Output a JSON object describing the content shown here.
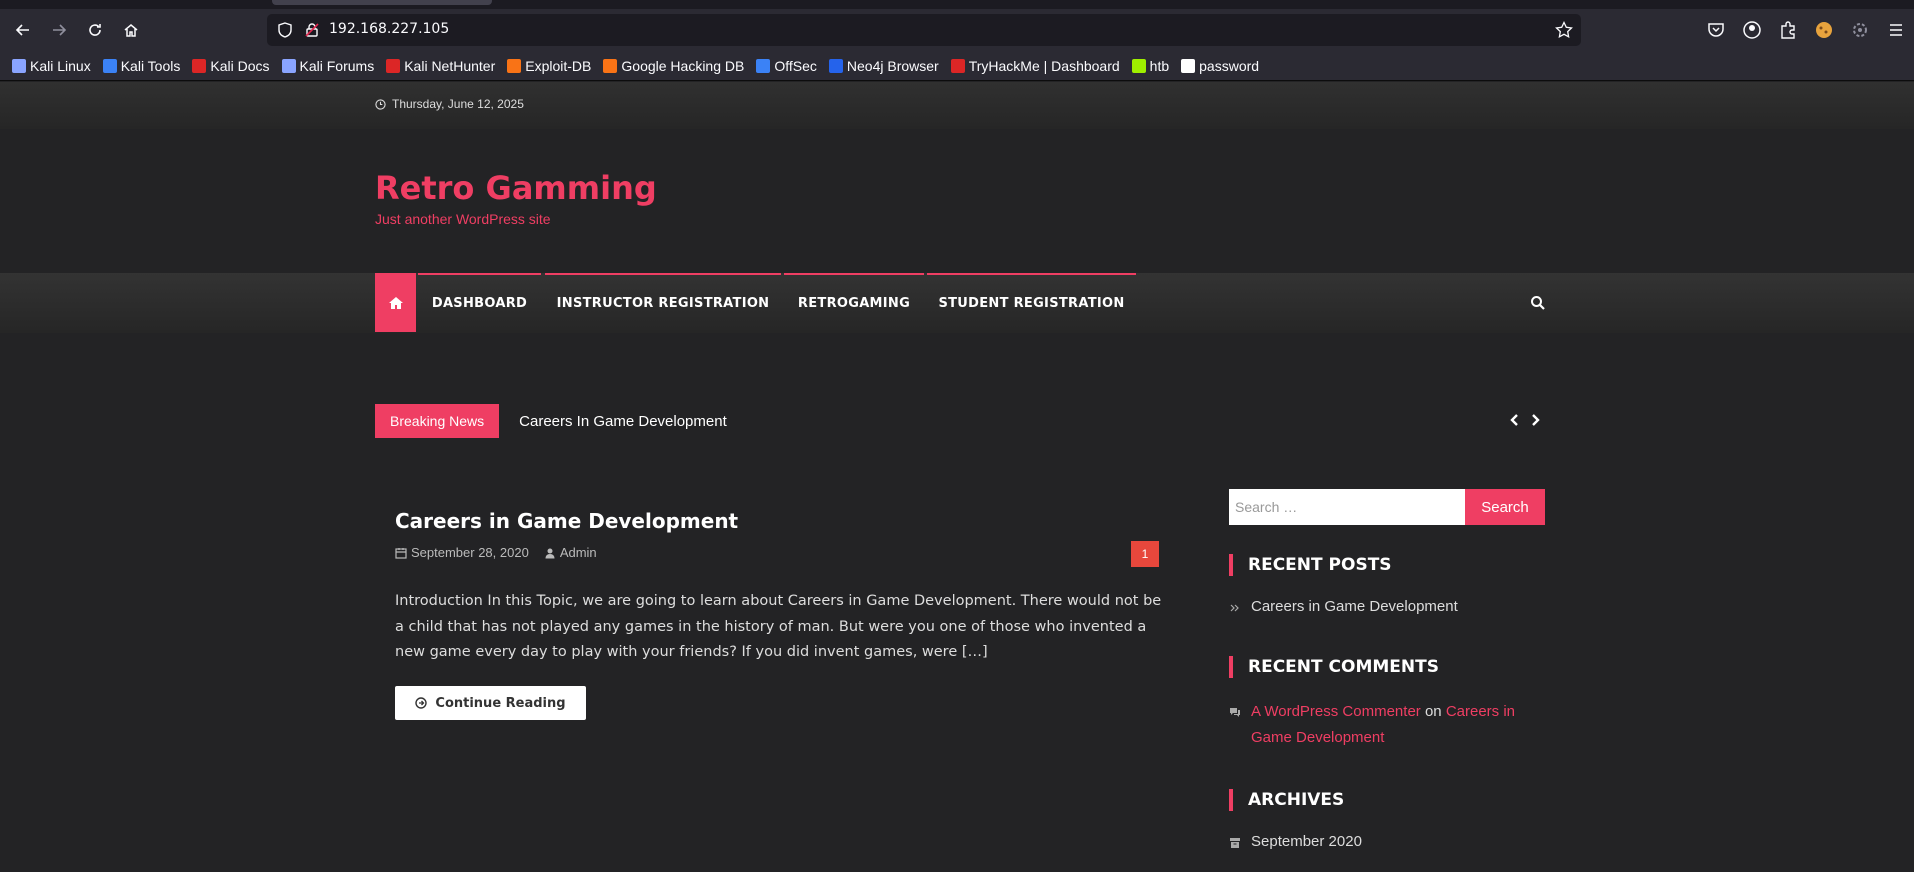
{
  "browser": {
    "url": "192.168.227.105",
    "bookmarks": [
      {
        "label": "Kali Linux",
        "color": "#8aa4ff"
      },
      {
        "label": "Kali Tools",
        "color": "#3b82f6"
      },
      {
        "label": "Kali Docs",
        "color": "#dc2626"
      },
      {
        "label": "Kali Forums",
        "color": "#8aa4ff"
      },
      {
        "label": "Kali NetHunter",
        "color": "#dc2626"
      },
      {
        "label": "Exploit-DB",
        "color": "#f97316"
      },
      {
        "label": "Google Hacking DB",
        "color": "#f97316"
      },
      {
        "label": "OffSec",
        "color": "#3b82f6"
      },
      {
        "label": "Neo4j Browser",
        "color": "#2563eb"
      },
      {
        "label": "TryHackMe | Dashboard",
        "color": "#dc2626"
      },
      {
        "label": "htb",
        "color": "#9fef00"
      },
      {
        "label": "password",
        "color": "#ffffff"
      }
    ]
  },
  "site": {
    "date": "Thursday, June 12, 2025",
    "title": "Retro Gamming",
    "tagline": "Just another WordPress site",
    "accent": "#ef3e63",
    "menu": [
      "DASHBOARD",
      "INSTRUCTOR REGISTRATION",
      "RETROGAMING",
      "STUDENT REGISTRATION"
    ],
    "breaking_label": "Breaking News",
    "breaking_headline": "Careers In Game Development"
  },
  "post": {
    "title": "Careers in Game Development",
    "date": "September 28, 2020",
    "author": "Admin",
    "comments": "1",
    "excerpt": "Introduction In this Topic, we are going to learn about Careers in Game Development. There would not be a child that has not played any games in the history of man. But were you one of those who invented a new game every day to play with your friends? If you did invent games, were […]",
    "continue_label": "Continue Reading"
  },
  "sidebar": {
    "search_placeholder": "Search …",
    "search_button": "Search",
    "recent_posts_title": "RECENT POSTS",
    "recent_posts": [
      "Careers in Game Development"
    ],
    "recent_comments_title": "RECENT COMMENTS",
    "comment_author": "A WordPress Commenter",
    "comment_on": "on",
    "comment_post": "Careers in Game Development",
    "archives_title": "ARCHIVES",
    "archives": [
      "September 2020"
    ]
  }
}
